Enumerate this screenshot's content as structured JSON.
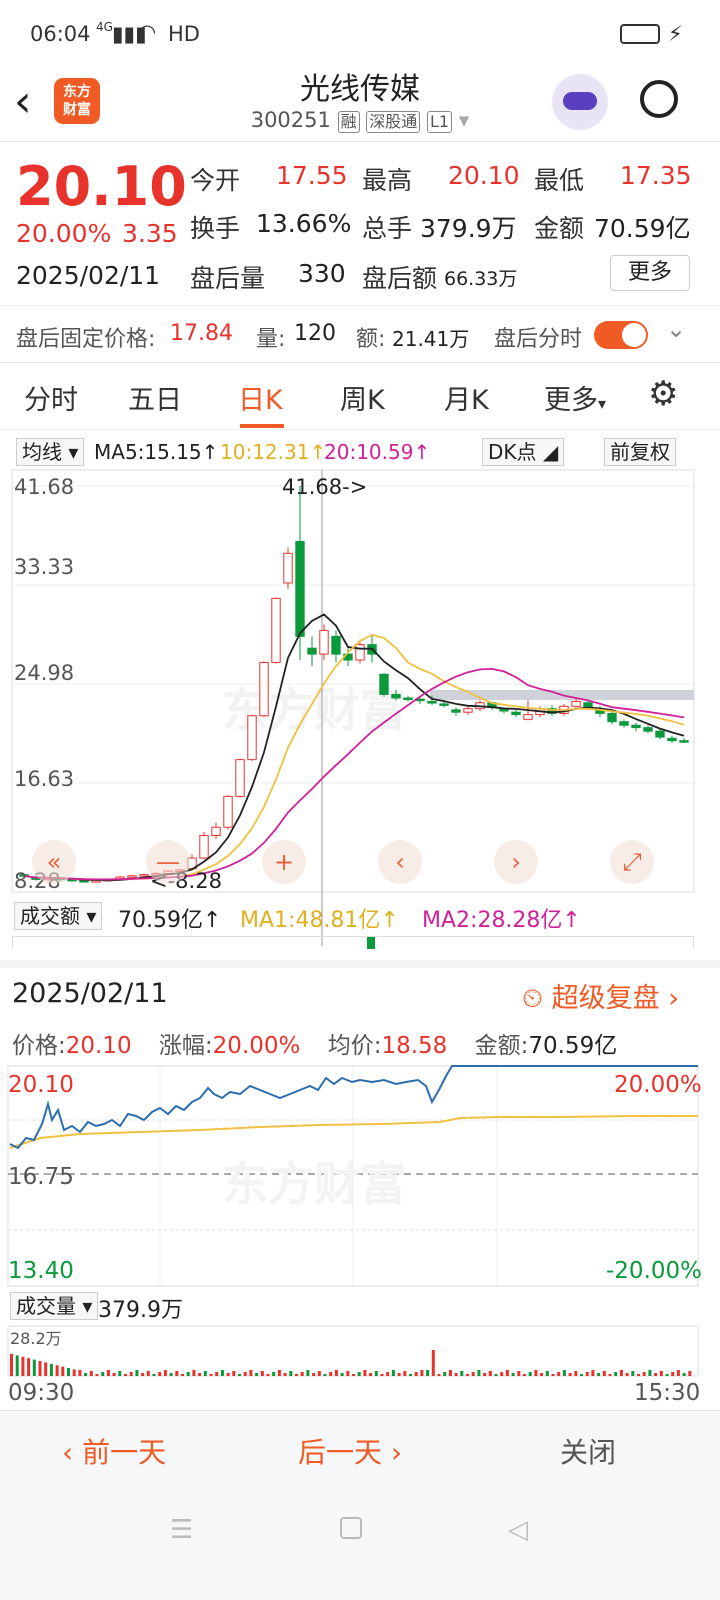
{
  "status": {
    "time": "06:04",
    "net": "4G",
    "hd": "HD"
  },
  "header": {
    "title": "光线传媒",
    "code": "300251",
    "tags": [
      "融",
      "深股通",
      "L1"
    ]
  },
  "quote": {
    "price": "20.10",
    "pct": "20.00%",
    "chg": "3.35",
    "date": "2025/02/11",
    "open_l": "今开",
    "open": "17.55",
    "high_l": "最高",
    "high": "20.10",
    "low_l": "最低",
    "low": "17.35",
    "turn_l": "换手",
    "turn": "13.66%",
    "vol_l": "总手",
    "vol": "379.9万",
    "amt_l": "金额",
    "amt": "70.59亿",
    "ah_vol_l": "盘后量",
    "ah_vol": "330",
    "ah_amt_l": "盘后额",
    "ah_amt": "66.33万",
    "more": "更多",
    "fix_l": "盘后固定价格:",
    "fix": "17.84",
    "fvol_l": "量:",
    "fvol": "120",
    "famt_l": "额:",
    "famt": "21.41万",
    "fen_l": "盘后分时"
  },
  "tabs": [
    "分时",
    "五日",
    "日K",
    "周K",
    "月K",
    "更多"
  ],
  "kline": {
    "ma_sel": "均线",
    "ma5": "MA5:15.15↑",
    "ma10": "10:12.31↑",
    "ma20": "20:10.59↑",
    "dk": "DK点",
    "fq": "前复权",
    "y_labels": [
      "41.68",
      "33.33",
      "24.98",
      "16.63",
      "8.28"
    ],
    "max_label": "41.68->",
    "min_label": "<-8.28",
    "vol_sel": "成交额",
    "vol_val": "70.59亿↑",
    "ma1": "MA1:48.81亿↑",
    "ma2": "MA2:28.28亿↑",
    "colors": {
      "up": "#e8322c",
      "down": "#0a9a3c",
      "ma5": "#222222",
      "ma10": "#f0c040",
      "ma20": "#d0209a"
    }
  },
  "chart_data": {
    "type": "candlestick",
    "ylim": [
      8.28,
      41.68
    ],
    "candles": [
      [
        8.9,
        8.8,
        9.0,
        8.6
      ],
      [
        8.7,
        8.5,
        8.8,
        8.4
      ],
      [
        8.5,
        8.6,
        8.7,
        8.4
      ],
      [
        8.6,
        8.5,
        8.7,
        8.3
      ],
      [
        8.5,
        8.4,
        8.6,
        8.3
      ],
      [
        8.4,
        8.3,
        8.5,
        8.28
      ],
      [
        8.3,
        8.4,
        8.5,
        8.28
      ],
      [
        8.4,
        8.5,
        8.6,
        8.3
      ],
      [
        8.5,
        8.7,
        8.8,
        8.4
      ],
      [
        8.7,
        8.8,
        8.9,
        8.6
      ],
      [
        8.8,
        8.9,
        9.0,
        8.7
      ],
      [
        8.9,
        9.0,
        9.1,
        8.8
      ],
      [
        9.0,
        9.2,
        9.3,
        8.9
      ],
      [
        9.2,
        9.3,
        9.4,
        9.1
      ],
      [
        9.4,
        10.3,
        10.6,
        9.3
      ],
      [
        10.3,
        12.2,
        12.5,
        10.2
      ],
      [
        12.2,
        12.9,
        13.3,
        11.9
      ],
      [
        12.9,
        15.5,
        15.6,
        12.7
      ],
      [
        15.5,
        18.6,
        18.7,
        15.4
      ],
      [
        18.6,
        22.3,
        22.4,
        18.5
      ],
      [
        22.3,
        26.8,
        26.9,
        22.2
      ],
      [
        26.8,
        32.2,
        32.3,
        26.7
      ],
      [
        33.5,
        36.0,
        36.5,
        33.0
      ],
      [
        37.0,
        29.0,
        41.68,
        27.0
      ],
      [
        28.0,
        27.5,
        29.0,
        26.5
      ],
      [
        27.5,
        29.5,
        30.0,
        27.0
      ],
      [
        29.0,
        27.5,
        29.5,
        26.8
      ],
      [
        27.5,
        27.0,
        28.0,
        26.5
      ],
      [
        27.0,
        28.3,
        28.5,
        26.7
      ],
      [
        28.3,
        27.5,
        29.2,
        26.8
      ],
      [
        25.8,
        24.1,
        25.9,
        23.9
      ],
      [
        24.1,
        23.8,
        24.5,
        23.6
      ],
      [
        23.8,
        23.7,
        24.0,
        23.5
      ],
      [
        23.7,
        23.6,
        24.0,
        23.3
      ],
      [
        23.5,
        23.4,
        24.0,
        23.2
      ],
      [
        23.3,
        23.2,
        23.6,
        23.0
      ],
      [
        22.8,
        22.6,
        23.0,
        22.3
      ],
      [
        22.6,
        22.9,
        23.1,
        22.4
      ],
      [
        22.9,
        23.4,
        23.6,
        22.7
      ],
      [
        23.4,
        23.0,
        23.5,
        22.8
      ],
      [
        22.9,
        22.7,
        23.0,
        22.5
      ],
      [
        22.6,
        22.4,
        22.8,
        22.2
      ],
      [
        22.0,
        22.4,
        23.6,
        21.9
      ],
      [
        22.4,
        22.9,
        23.1,
        22.2
      ],
      [
        22.9,
        22.5,
        23.2,
        22.3
      ],
      [
        22.5,
        23.1,
        23.3,
        22.3
      ],
      [
        23.1,
        23.5,
        23.7,
        22.9
      ],
      [
        23.4,
        23.0,
        23.6,
        22.8
      ],
      [
        22.9,
        22.5,
        23.1,
        22.2
      ],
      [
        22.5,
        21.8,
        22.6,
        21.6
      ],
      [
        21.8,
        21.5,
        22.0,
        21.3
      ],
      [
        21.5,
        21.3,
        21.7,
        21.0
      ],
      [
        21.3,
        21.0,
        21.5,
        20.8
      ],
      [
        21.0,
        20.5,
        21.2,
        20.3
      ],
      [
        20.4,
        20.2,
        20.6,
        20.0
      ],
      [
        20.2,
        20.1,
        20.4,
        20.0
      ]
    ]
  },
  "intraday": {
    "date": "2025/02/11",
    "link": "超级复盘",
    "price_l": "价格:",
    "price": "20.10",
    "pct_l": "涨幅:",
    "pct": "20.00%",
    "avg_l": "均价:",
    "avg": "18.58",
    "amt_l": "金额:",
    "amt": "70.59亿",
    "y_top": "20.10",
    "y_mid": "16.75",
    "y_bot": "13.40",
    "p_top": "20.00%",
    "p_bot": "-20.00%",
    "vol_sel": "成交量",
    "vol": "379.9万",
    "vmax": "28.2万",
    "t_start": "09:30",
    "t_end": "15:30"
  },
  "bottom": {
    "prev": "前一天",
    "next": "后一天",
    "close": "关闭"
  }
}
